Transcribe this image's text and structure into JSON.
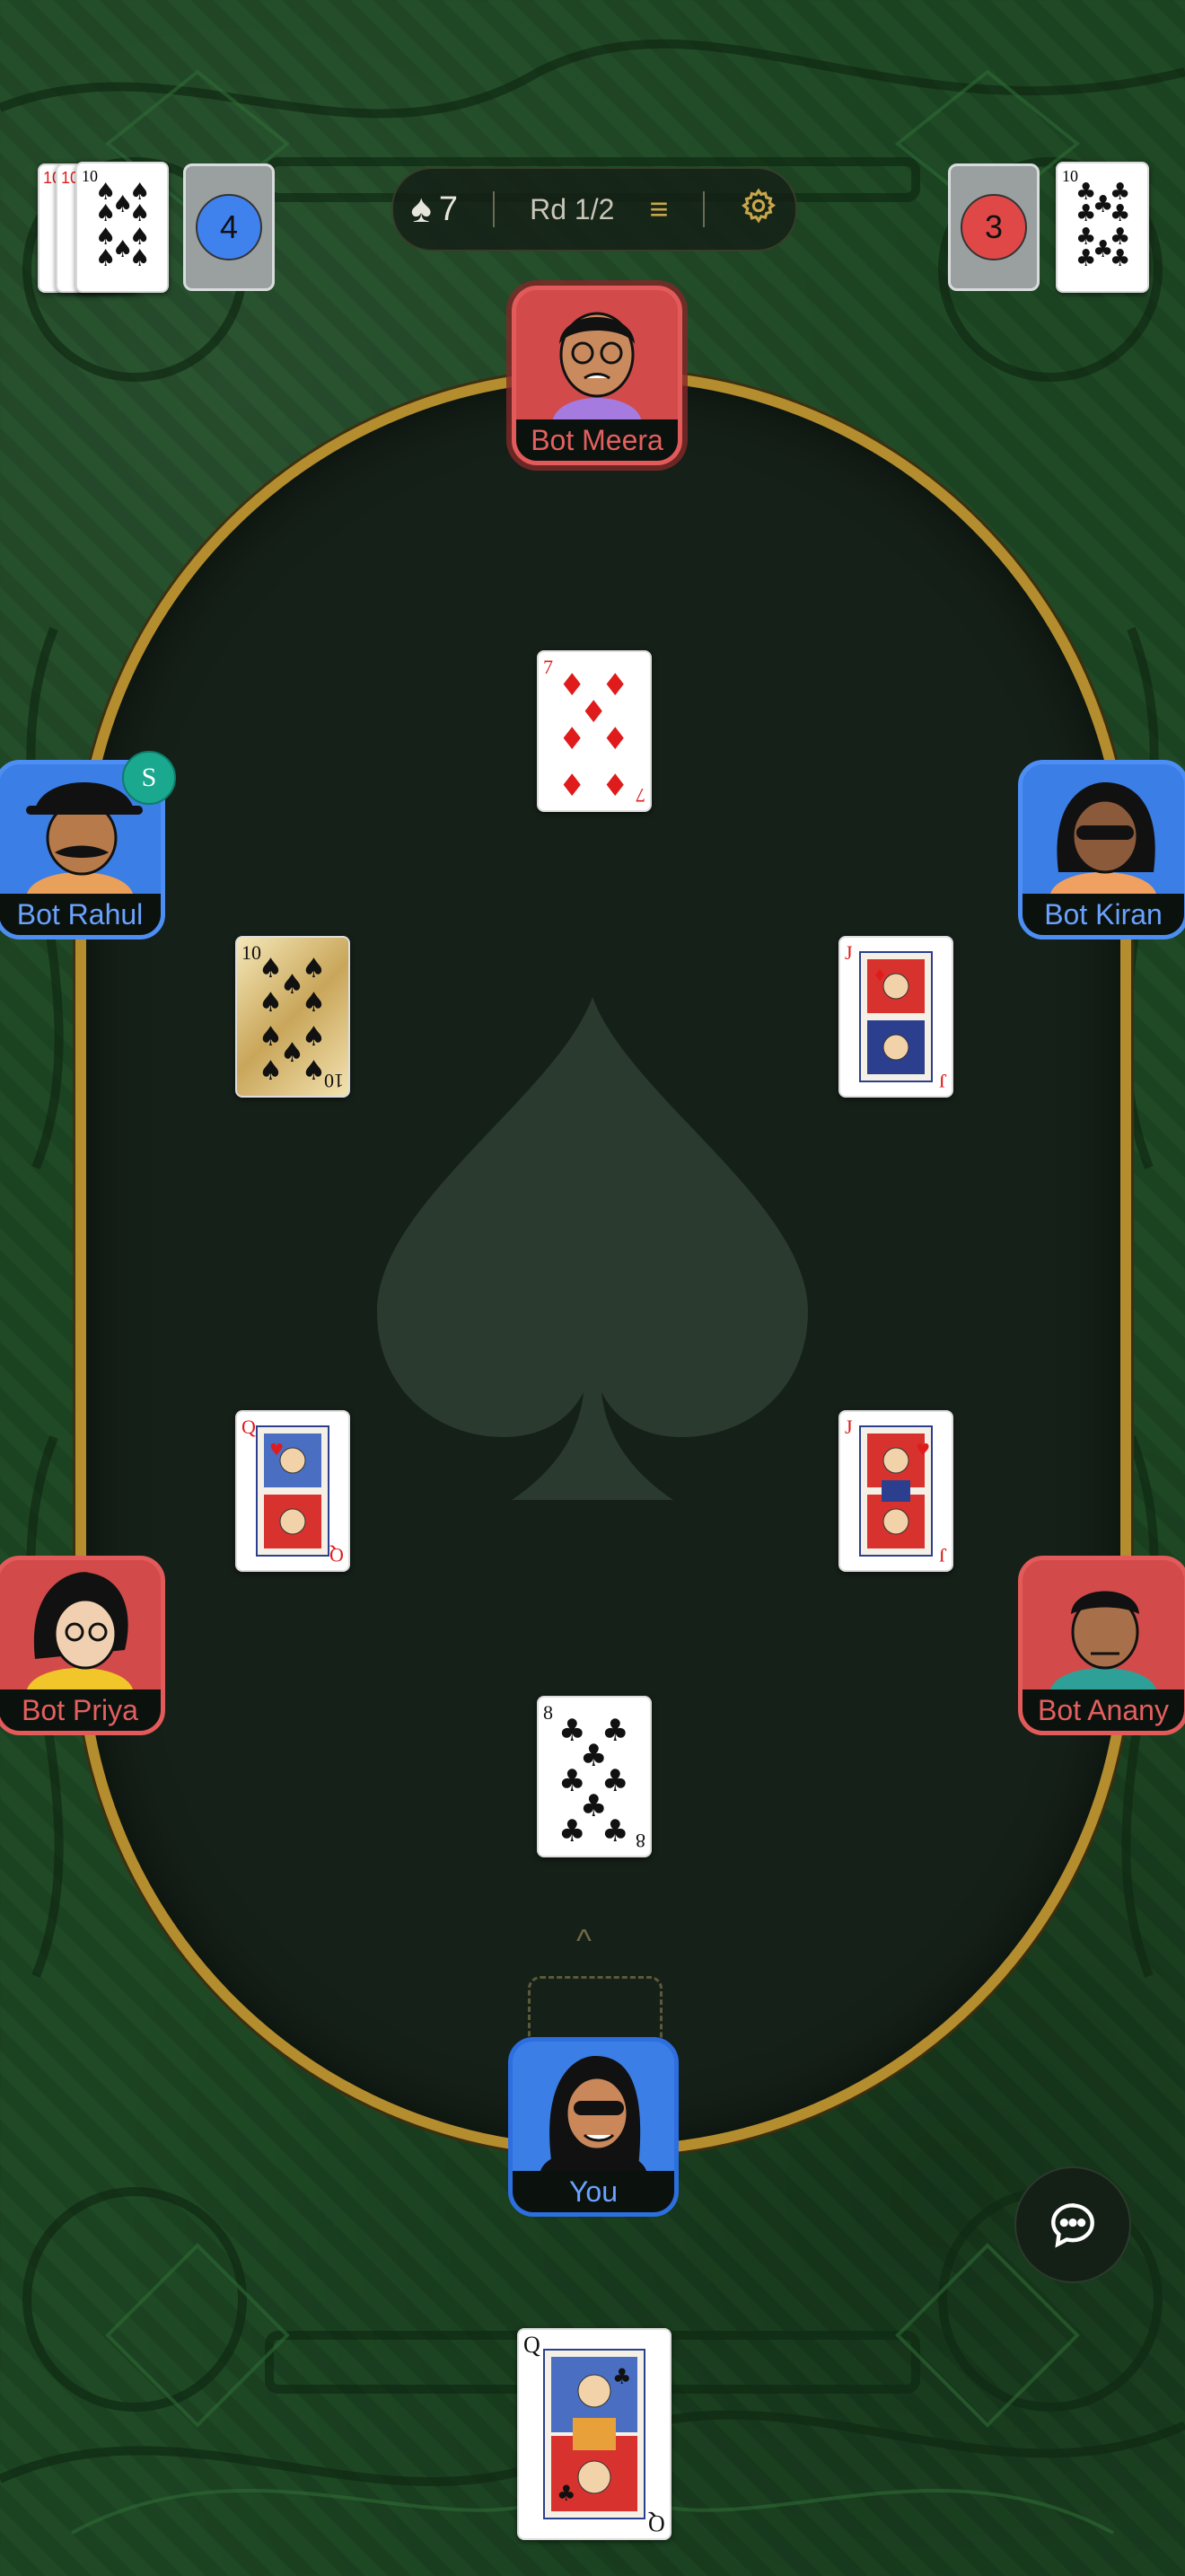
{
  "hud": {
    "trump_value": "7",
    "round_label": "Rd 1/2",
    "menu_icon": "hamburger-icon",
    "settings_icon": "gear-icon"
  },
  "score_left": {
    "value": "4",
    "color": "#3f82ee"
  },
  "score_right": {
    "value": "3",
    "color": "#e04848"
  },
  "corner_left_cards": [
    {
      "rank": "10",
      "suit": "♥"
    },
    {
      "rank": "10",
      "suit": "♦"
    },
    {
      "rank": "10",
      "suit": "♠"
    }
  ],
  "corner_right_card": {
    "rank": "10",
    "suit": "♣"
  },
  "players": {
    "top": {
      "name": "Bot Meera",
      "team": "red"
    },
    "left_upper": {
      "name": "Bot Rahul",
      "team": "blue",
      "badge": "S"
    },
    "right_upper": {
      "name": "Bot Kiran",
      "team": "blue"
    },
    "left_lower": {
      "name": "Bot Priya",
      "team": "red"
    },
    "right_lower": {
      "name": "Bot Anany",
      "team": "red"
    },
    "bottom": {
      "name": "You",
      "team": "blue"
    }
  },
  "played_cards": {
    "top": {
      "rank": "7",
      "suit": "♦",
      "color": "red"
    },
    "left_upper": {
      "rank": "10",
      "suit": "♠",
      "color": "black"
    },
    "right_upper": {
      "rank": "J",
      "suit": "♦",
      "color": "red"
    },
    "left_lower": {
      "rank": "Q",
      "suit": "♥",
      "color": "red"
    },
    "right_lower": {
      "rank": "J",
      "suit": "♥",
      "color": "red"
    },
    "bottom": {
      "rank": "8",
      "suit": "♣",
      "color": "black"
    }
  },
  "hand": [
    {
      "rank": "Q",
      "suit": "♣",
      "color": "black"
    }
  ],
  "chat_icon": "chat-bubble-icon",
  "colors": {
    "table_rim": "#b48d2e",
    "felt": "#152018",
    "background": "#1e4823"
  }
}
